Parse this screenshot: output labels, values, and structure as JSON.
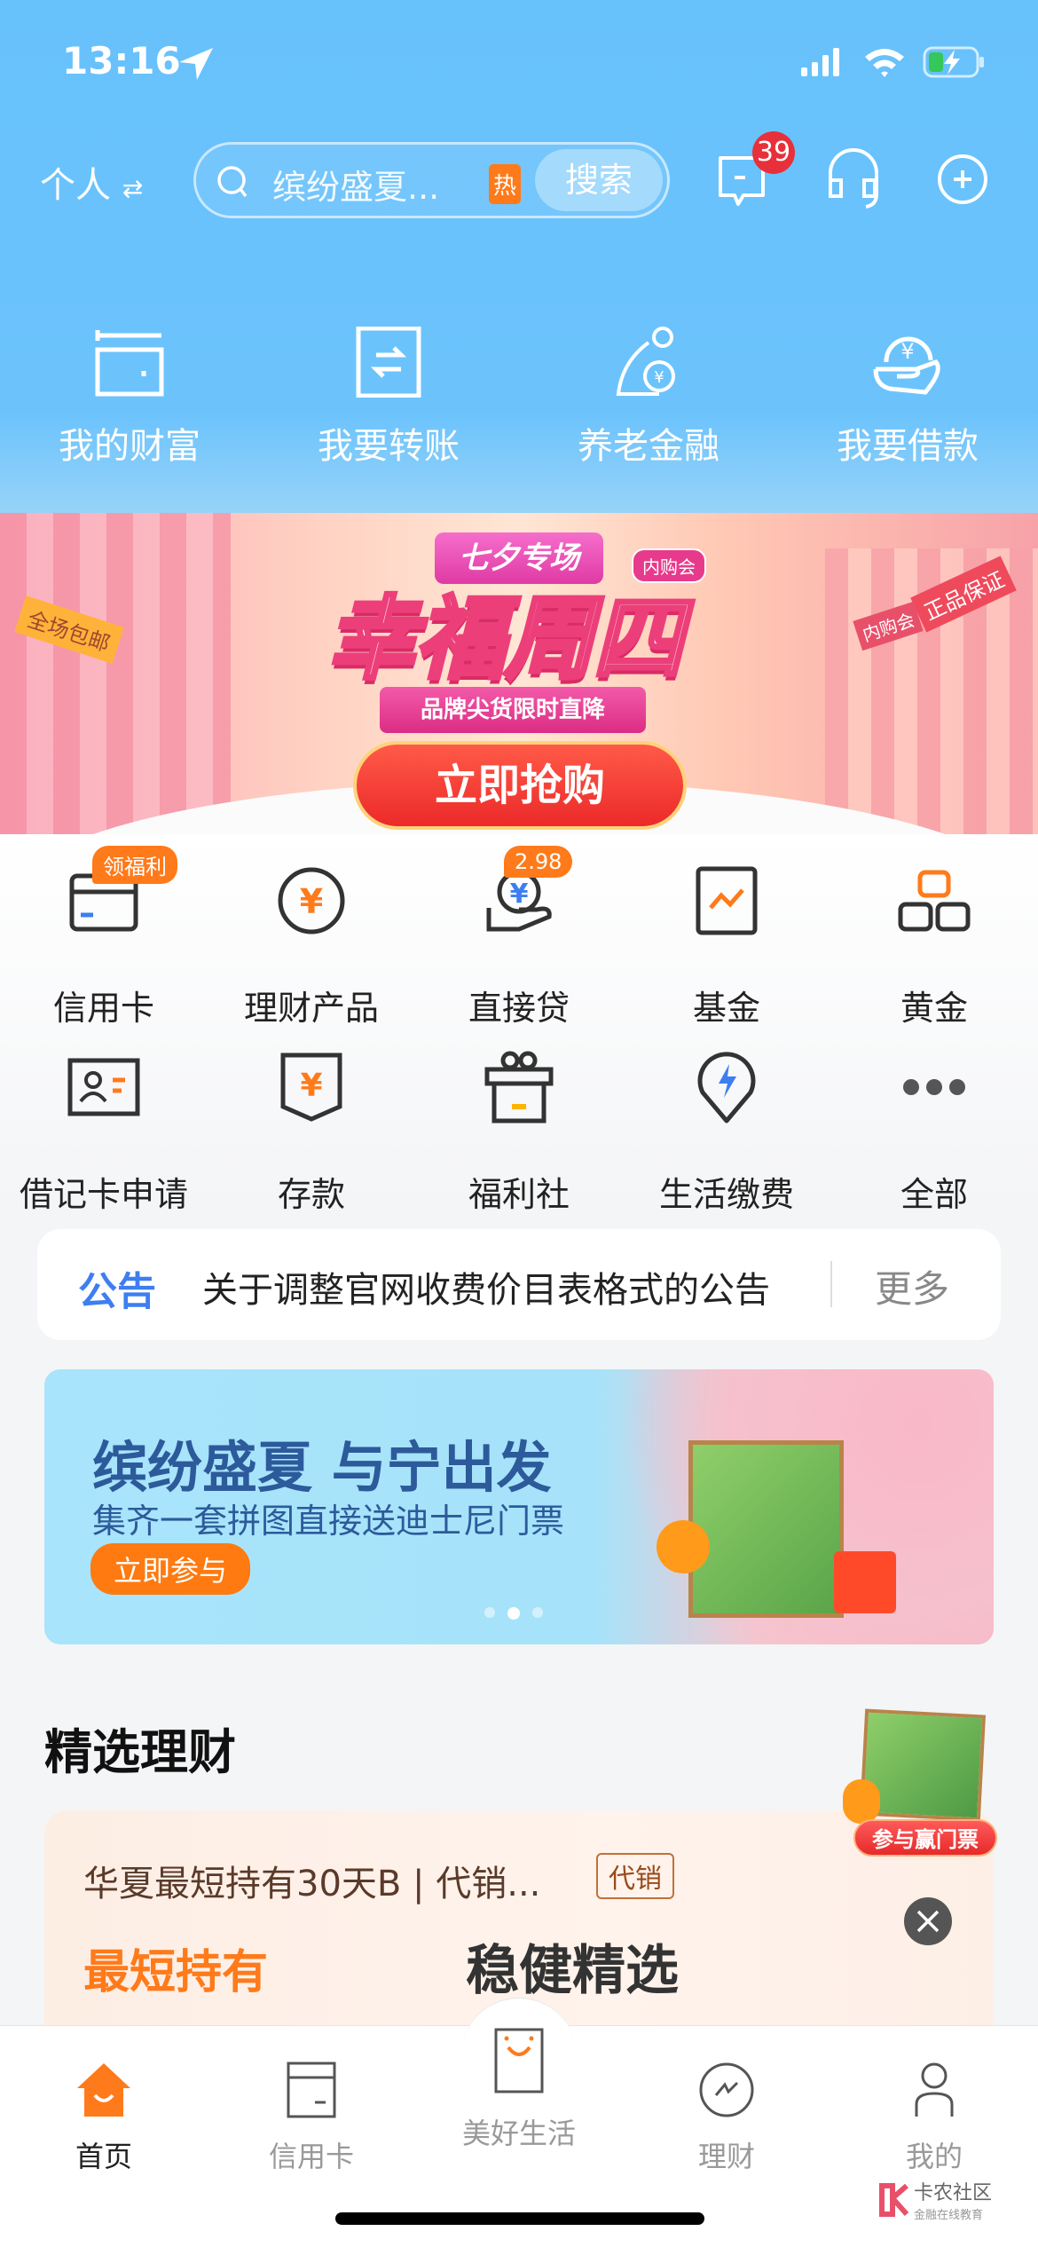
{
  "status_bar": {
    "time": "13:16"
  },
  "header": {
    "account_switch": "个人",
    "search_placeholder": "缤纷盛夏...",
    "hot_tag": "热",
    "search_button": "搜索",
    "message_count": "39"
  },
  "quick_actions": [
    {
      "label": "我的财富",
      "icon": "wallet-icon"
    },
    {
      "label": "我要转账",
      "icon": "transfer-icon"
    },
    {
      "label": "养老金融",
      "icon": "pension-icon"
    },
    {
      "label": "我要借款",
      "icon": "loan-icon"
    }
  ],
  "hero_banner": {
    "tag": "七夕专场",
    "corner_tag": "内购会",
    "title": "幸福周四",
    "subtitle": "品牌尖货限时直降",
    "cta": "立即抢购",
    "sign_left": "全场包邮",
    "sign_right": "正品保证",
    "sign_right2": "内购会"
  },
  "services": [
    {
      "label": "信用卡",
      "badge": "领福利",
      "icon": "credit-card-icon"
    },
    {
      "label": "理财产品",
      "icon": "yen-coin-icon"
    },
    {
      "label": "直接贷",
      "badge": "2.98",
      "icon": "hand-coin-icon"
    },
    {
      "label": "基金",
      "icon": "fund-chart-icon"
    },
    {
      "label": "黄金",
      "icon": "gold-bars-icon"
    },
    {
      "label": "借记卡申请",
      "icon": "id-card-icon"
    },
    {
      "label": "存款",
      "icon": "deposit-icon"
    },
    {
      "label": "福利社",
      "icon": "gift-icon"
    },
    {
      "label": "生活缴费",
      "icon": "bolt-pin-icon"
    },
    {
      "label": "全部",
      "icon": "more-dots-icon"
    }
  ],
  "notice": {
    "label": "公告",
    "text": "关于调整官网收费价目表格式的公告",
    "more": "更多"
  },
  "promo": {
    "title": "缤纷盛夏 与宁出发",
    "subtitle": "集齐一套拼图直接送迪士尼门票",
    "cta": "立即参与",
    "active_dot": 2,
    "dots": 3
  },
  "featured": {
    "title": "精选理财",
    "float_label": "参与赢门票",
    "product": {
      "name": "华夏最短持有30天B | 代销...",
      "tag": "代销",
      "left_label": "最短持有",
      "right_label": "稳健精选"
    }
  },
  "tabbar": [
    {
      "label": "首页",
      "active": true
    },
    {
      "label": "信用卡"
    },
    {
      "label": "美好生活"
    },
    {
      "label": "理财"
    },
    {
      "label": "我的"
    }
  ],
  "watermark": {
    "name": "卡农社区",
    "sub": "金融在线教育"
  },
  "colors": {
    "header_blue": "#67c1fb",
    "accent_orange": "#ff7a1a",
    "badge_red": "#e8303a",
    "notice_blue": "#3d7ef0"
  }
}
